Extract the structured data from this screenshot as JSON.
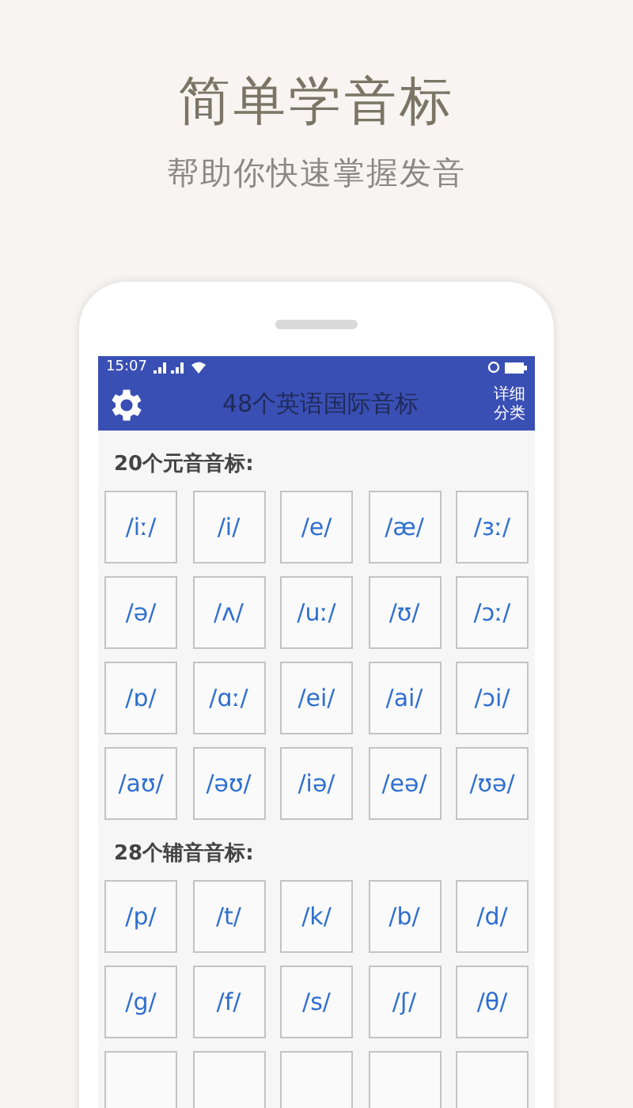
{
  "headline": "简单学音标",
  "subheadline": "帮助你快速掌握发音",
  "phone": {
    "status_bar": {
      "time": "15:07"
    },
    "app_bar": {
      "title": "48个英语国际音标",
      "action": "详细分类"
    },
    "sections": [
      {
        "heading": "20个元音音标:",
        "symbols": [
          "/iː/",
          "/i/",
          "/e/",
          "/æ/",
          "/ɜː/",
          "/ə/",
          "/ʌ/",
          "/uː/",
          "/ʊ/",
          "/ɔː/",
          "/ɒ/",
          "/ɑː/",
          "/ei/",
          "/ai/",
          "/ɔi/",
          "/aʊ/",
          "/əʊ/",
          "/iə/",
          "/eə/",
          "/ʊə/"
        ]
      },
      {
        "heading": "28个辅音音标:",
        "symbols": [
          "/p/",
          "/t/",
          "/k/",
          "/b/",
          "/d/",
          "/g/",
          "/f/",
          "/s/",
          "/ʃ/",
          "/θ/"
        ]
      }
    ]
  }
}
